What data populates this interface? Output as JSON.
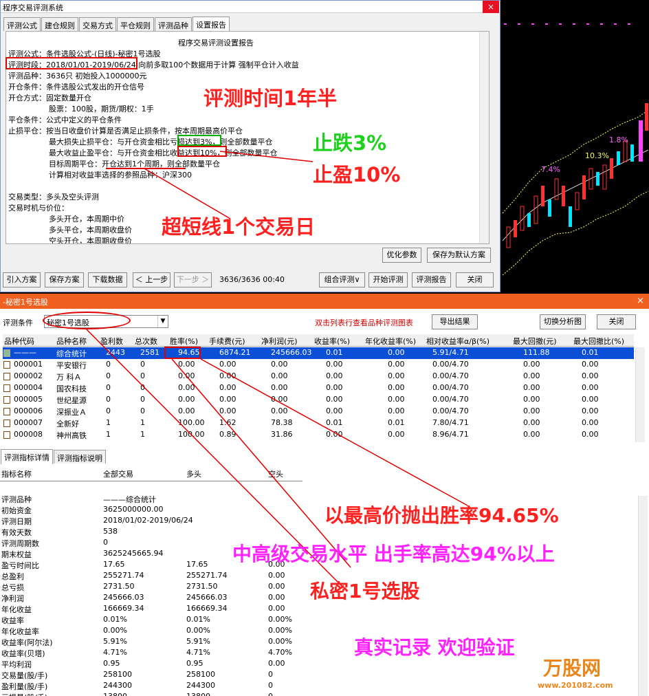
{
  "win1": {
    "title": "程序交易评测系统",
    "close": "×",
    "tabs": [
      "评测公式",
      "建仓规则",
      "交易方式",
      "平仓规则",
      "评测品种",
      "设置报告"
    ],
    "report_title": "程序交易评测设置报告",
    "lines": [
      "评测公式：条件选股公式-(日线)-秘密1号选股",
      "评测时段：2018/01/01-2019/06/24 向前多取100个数据用于计算 强制平仓计入收益",
      "评测品种：3636只 初始投入1000000元",
      "开仓条件：条件选股公式发出的开仓信号",
      "开仓方式：固定数量开仓",
      "股票：100股，期货/期权：1手",
      "平仓条件：公式中定义的平仓条件",
      "止损平仓：按当日收盘价计算是否满足止损条件，按本周期最高价平仓",
      "最大损失止损平仓：与开仓资金相比亏损达到3%，则全部数量平仓",
      "最大收益止盈平仓：与开仓资金相比收益达到10%，则全部数量平仓",
      "目标周期平仓：开仓达到1个周期，则全部数量平仓",
      "计算相对收益率选择的参照品种：沪深300",
      "交易类型：多头及空头评测",
      "交易时机与价位：",
      "多头开仓，本周期中价",
      "多头平仓，本周期收盘价",
      "空头开仓，本周期收盘价"
    ],
    "btn_optimize": "优化参数",
    "btn_save_default": "保存为默认方案",
    "bottom": [
      "引入方案",
      "保存方案",
      "下载数据",
      "＜ 上一步",
      "下一步 ＞",
      "组合评测∨",
      "开始评测",
      "评测报告",
      "关闭"
    ],
    "progress": "3636/3636 00:40"
  },
  "chart": {
    "labels": [
      "7.4%",
      "10.3%",
      "1.8%"
    ]
  },
  "win2": {
    "title": "-秘密1号选股",
    "close": "×",
    "cond_label": "评测条件",
    "cond_value": "秘密1号选股",
    "hint": "双击列表行查看品种评测图表",
    "btn_export": "导出结果",
    "btn_switch": "切换分析图",
    "btn_close": "关闭",
    "headers": [
      "品种代码",
      "品种名称",
      "盈利数",
      "总次数",
      "胜率(%)",
      "手续费(元)",
      "净利润(元)",
      "收益率(%)",
      "年化收益率(%)",
      "相对收益率α/β(%)",
      "最大回撤(元)",
      "最大回撤比(%)"
    ],
    "rows": [
      [
        "———",
        "综合统计",
        "2443",
        "2581",
        "94.65",
        "6874.21",
        "245666.03",
        "0.01",
        "0.00",
        "5.91/4.71",
        "111.88",
        "0.01"
      ],
      [
        "000001",
        "平安银行",
        "0",
        "0",
        "0.00",
        "0.00",
        "0.00",
        "0.00",
        "0.00",
        "0.00/4.70",
        "0.00",
        "0.00"
      ],
      [
        "000002",
        "万 科Ａ",
        "0",
        "0",
        "0.00",
        "0.00",
        "0.00",
        "0.00",
        "0.00",
        "0.00/4.70",
        "0.00",
        "0.00"
      ],
      [
        "000004",
        "国农科技",
        "0",
        "0",
        "0.00",
        "0.00",
        "0.00",
        "0.00",
        "0.00",
        "0.00/4.70",
        "0.00",
        "0.00"
      ],
      [
        "000005",
        "世纪星源",
        "0",
        "0",
        "0.00",
        "0.00",
        "0.00",
        "0.00",
        "0.00",
        "0.00/4.70",
        "0.00",
        "0.00"
      ],
      [
        "000006",
        "深振业Ａ",
        "0",
        "0",
        "0.00",
        "0.00",
        "0.00",
        "0.00",
        "0.00",
        "0.00/4.70",
        "0.00",
        "0.00"
      ],
      [
        "000007",
        "全新好",
        "1",
        "1",
        "100.00",
        "1.62",
        "78.38",
        "0.01",
        "0.01",
        "7.80/4.71",
        "0.00",
        "0.00"
      ],
      [
        "000008",
        "神州高铁",
        "1",
        "1",
        "100.00",
        "0.89",
        "31.86",
        "0.00",
        "0.00",
        "8.96/4.71",
        "0.00",
        "0.00"
      ]
    ],
    "detail_tabs": [
      "评测指标详情",
      "评测指标说明"
    ],
    "detail_headers": [
      "指标名称",
      "全部交易",
      "多头",
      "空头"
    ],
    "detail_rows": [
      [
        "评测品种",
        "———综合统计",
        "",
        ""
      ],
      [
        "初始资金",
        "3625000000.00",
        "",
        ""
      ],
      [
        "评测日期",
        "2018/01/02-2019/06/24",
        "",
        ""
      ],
      [
        "有效天数",
        "538",
        "",
        ""
      ],
      [
        "评测周期数",
        "0",
        "",
        ""
      ],
      [
        "期末权益",
        "3625245665.94",
        "",
        ""
      ],
      [
        "盈亏时间比",
        "17.65",
        "17.65",
        "0.00"
      ],
      [
        "总盈利",
        "255271.74",
        "255271.74",
        "0.00"
      ],
      [
        "总亏损",
        "2731.50",
        "2731.50",
        "0.00"
      ],
      [
        "净利润",
        "245666.03",
        "245666.03",
        "0.00"
      ],
      [
        "年化收益",
        "166669.34",
        "166669.34",
        "0.00"
      ],
      [
        "收益率",
        "0.01%",
        "0.01%",
        "0.00%"
      ],
      [
        "年化收益率",
        "0.00%",
        "0.00%",
        "0.00%"
      ],
      [
        "收益率(阿尔法)",
        "5.91%",
        "5.91%",
        "0.00%"
      ],
      [
        "收益率(贝塔)",
        "4.71%",
        "4.71%",
        "4.70%"
      ],
      [
        "平均利润",
        "0.95",
        "0.95",
        "0.00"
      ],
      [
        "交易量(股/手)",
        "258100",
        "258100",
        "0"
      ],
      [
        "盈利量(股/手)",
        "244300",
        "244300",
        "0"
      ],
      [
        "亏损量(股/手)",
        "13800",
        "13800",
        "0"
      ]
    ]
  },
  "annotations": {
    "a1": "评测时间1年半",
    "a2": "止跌3%",
    "a3": "止盈10%",
    "a4": "超短线1个交易日",
    "a5": "以最高价抛出胜率94.65%",
    "a6": "中高级交易水平 出手率高达94%以上",
    "a7": "私密1号选股",
    "a8": "真实记录  欢迎验证"
  },
  "watermark": {
    "brand": "万股网",
    "url": "www.201082.com"
  }
}
